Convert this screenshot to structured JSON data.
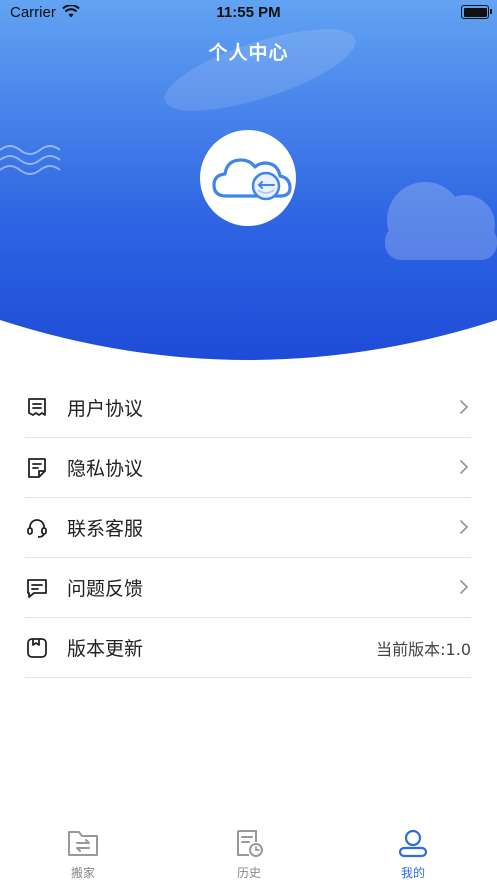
{
  "status_bar": {
    "carrier": "Carrier",
    "time": "11:55 PM"
  },
  "header": {
    "title": "个人中心"
  },
  "colors": {
    "accent": "#2a6be6",
    "header_top": "#5fa0f0",
    "header_bottom": "#1e4fd9"
  },
  "menu": [
    {
      "label": "用户协议",
      "icon": "document-icon",
      "value": ""
    },
    {
      "label": "隐私协议",
      "icon": "privacy-document-icon",
      "value": ""
    },
    {
      "label": "联系客服",
      "icon": "headset-icon",
      "value": ""
    },
    {
      "label": "问题反馈",
      "icon": "feedback-message-icon",
      "value": ""
    },
    {
      "label": "版本更新",
      "icon": "version-icon",
      "value": "当前版本:1.0"
    }
  ],
  "tabs": [
    {
      "label": "搬家",
      "icon": "folder-transfer-icon",
      "active": false
    },
    {
      "label": "历史",
      "icon": "history-document-icon",
      "active": false
    },
    {
      "label": "我的",
      "icon": "user-icon",
      "active": true
    }
  ]
}
